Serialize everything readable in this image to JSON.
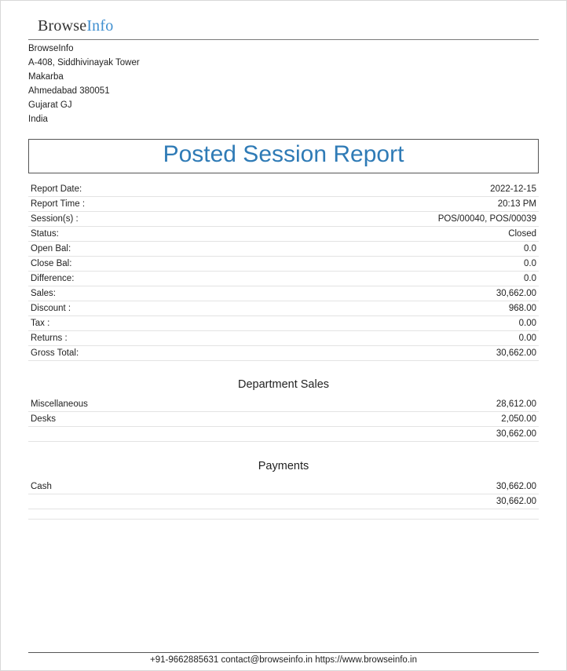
{
  "logo": {
    "part1": "Browse",
    "part2": "Info"
  },
  "company": {
    "name": "BrowseInfo",
    "street": "A-408, Siddhivinayak Tower",
    "area": "Makarba",
    "city_zip": "Ahmedabad 380051",
    "state": "Gujarat GJ",
    "country": "India"
  },
  "report": {
    "title": "Posted Session Report",
    "rows": [
      {
        "label": "Report Date:",
        "value": "2022-12-15"
      },
      {
        "label": "Report Time :",
        "value": "20:13 PM"
      },
      {
        "label": "Session(s) :",
        "value": "POS/00040, POS/00039"
      },
      {
        "label": "Status:",
        "value": "Closed"
      },
      {
        "label": "Open Bal:",
        "value": "0.0"
      },
      {
        "label": "Close Bal:",
        "value": "0.0"
      },
      {
        "label": "Difference:",
        "value": "0.0"
      },
      {
        "label": "Sales:",
        "value": "30,662.00"
      },
      {
        "label": "Discount :",
        "value": "968.00"
      },
      {
        "label": "Tax :",
        "value": "0.00"
      },
      {
        "label": "Returns :",
        "value": "0.00"
      },
      {
        "label": "Gross Total:",
        "value": "30,662.00"
      }
    ]
  },
  "department_sales": {
    "title": "Department Sales",
    "rows": [
      {
        "label": "Miscellaneous",
        "value": "28,612.00"
      },
      {
        "label": "Desks",
        "value": "2,050.00"
      },
      {
        "label": "",
        "value": "30,662.00"
      }
    ]
  },
  "payments": {
    "title": "Payments",
    "rows": [
      {
        "label": "Cash",
        "value": "30,662.00"
      },
      {
        "label": "",
        "value": "30,662.00"
      },
      {
        "label": "",
        "value": ""
      }
    ]
  },
  "footer": {
    "text": "+91-9662885631 contact@browseinfo.in https://www.browseinfo.in"
  }
}
